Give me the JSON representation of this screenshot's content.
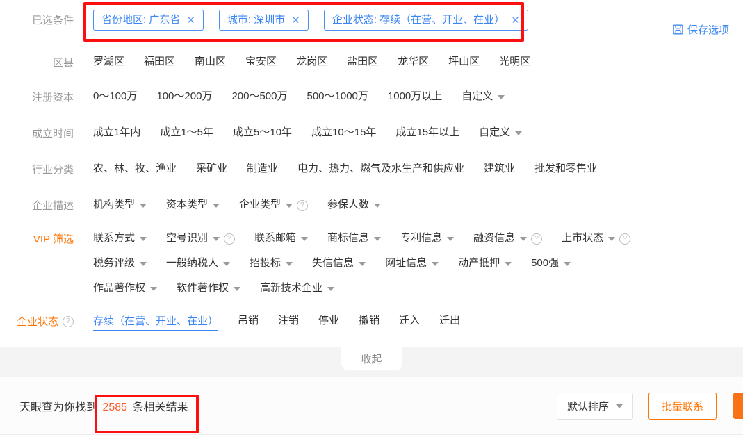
{
  "selected": {
    "label": "已选条件",
    "tags": [
      {
        "text": "省份地区: 广东省",
        "close": "✕",
        "name": "tag-province"
      },
      {
        "text": "城市: 深圳市",
        "close": "✕",
        "name": "tag-city"
      },
      {
        "text": "企业状态: 存续（在营、开业、在业）",
        "close": "✕",
        "name": "tag-status"
      }
    ],
    "save_label": "保存选项",
    "save_icon": "save-floppy-icon"
  },
  "rows": {
    "district": {
      "label": "区县",
      "items": [
        "罗湖区",
        "福田区",
        "南山区",
        "宝安区",
        "龙岗区",
        "盐田区",
        "龙华区",
        "坪山区",
        "光明区"
      ]
    },
    "capital": {
      "label": "注册资本",
      "items": [
        "0～100万",
        "100～200万",
        "200～500万",
        "500～1000万",
        "1000万以上"
      ],
      "custom": "自定义"
    },
    "founded": {
      "label": "成立时间",
      "items": [
        "成立1年内",
        "成立1～5年",
        "成立5～10年",
        "成立10～15年",
        "成立15年以上"
      ],
      "custom": "自定义"
    },
    "industry": {
      "label": "行业分类",
      "items": [
        "农、林、牧、渔业",
        "采矿业",
        "制造业",
        "电力、热力、燃气及水生产和供应业",
        "建筑业",
        "批发和零售业"
      ]
    },
    "description": {
      "label": "企业描述",
      "items": [
        {
          "text": "机构类型",
          "caret": true,
          "help": false
        },
        {
          "text": "资本类型",
          "caret": true,
          "help": false
        },
        {
          "text": "企业类型",
          "caret": true,
          "help": true
        },
        {
          "text": "参保人数",
          "caret": true,
          "help": false
        }
      ]
    },
    "vip": {
      "label": "VIP 筛选",
      "lines": [
        [
          {
            "text": "联系方式",
            "caret": true,
            "help": false
          },
          {
            "text": "空号识别",
            "caret": true,
            "help": true
          },
          {
            "text": "联系邮箱",
            "caret": true,
            "help": false
          },
          {
            "text": "商标信息",
            "caret": true,
            "help": false
          },
          {
            "text": "专利信息",
            "caret": true,
            "help": false
          },
          {
            "text": "融资信息",
            "caret": true,
            "help": true
          },
          {
            "text": "上市状态",
            "caret": true,
            "help": true
          }
        ],
        [
          {
            "text": "税务评级",
            "caret": true,
            "help": false
          },
          {
            "text": "一般纳税人",
            "caret": true,
            "help": false
          },
          {
            "text": "招投标",
            "caret": true,
            "help": false
          },
          {
            "text": "失信信息",
            "caret": true,
            "help": false
          },
          {
            "text": "网址信息",
            "caret": true,
            "help": false
          },
          {
            "text": "动产抵押",
            "caret": true,
            "help": false
          },
          {
            "text": "500强",
            "caret": true,
            "help": false
          }
        ],
        [
          {
            "text": "作品著作权",
            "caret": true,
            "help": false
          },
          {
            "text": "软件著作权",
            "caret": true,
            "help": false
          },
          {
            "text": "高新技术企业",
            "caret": true,
            "help": false
          }
        ]
      ]
    },
    "status": {
      "label": "企业状态",
      "help": true,
      "items": [
        {
          "text": "存续（在营、开业、在业）",
          "selected": true
        },
        {
          "text": "吊销",
          "selected": false
        },
        {
          "text": "注销",
          "selected": false
        },
        {
          "text": "停业",
          "selected": false
        },
        {
          "text": "撤销",
          "selected": false
        },
        {
          "text": "迁入",
          "selected": false
        },
        {
          "text": "迁出",
          "selected": false
        }
      ]
    }
  },
  "collapse": {
    "label": "收起"
  },
  "results": {
    "prefix": "天眼查为你找到",
    "count": "2585",
    "suffix": "条相关结果",
    "sort_label": "默认排序",
    "contact_label": "批量联系"
  },
  "colors": {
    "accent_orange": "#ff7300",
    "link_blue": "#3b86f3",
    "count_red": "#ff5a28",
    "annotation_red": "#fb0f0f",
    "label_gray": "#999999"
  }
}
